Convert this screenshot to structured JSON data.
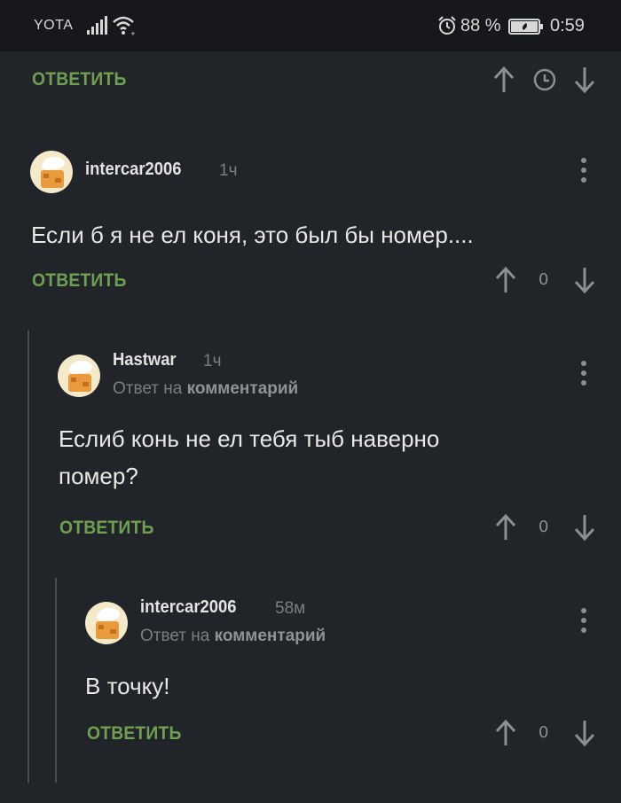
{
  "status_bar": {
    "carrier": "YOTA",
    "battery_percent": "88 %",
    "time": "0:59"
  },
  "top_actions": {
    "reply_label": "ОТВЕТИТЬ"
  },
  "comments": [
    {
      "username": "intercar2006",
      "time": "1ч",
      "reply_to_prefix": "",
      "reply_to_target": "",
      "text": "Если б я не ел коня, это был бы номер....",
      "reply_label": "ОТВЕТИТЬ",
      "rating": "0"
    },
    {
      "username": "Hastwar",
      "time": "1ч",
      "reply_to_prefix": "Ответ на",
      "reply_to_target": "комментарий",
      "text_line1": "Еслиб конь не ел тебя тыб наверно",
      "text_line2": "помер?",
      "reply_label": "ОТВЕТИТЬ",
      "rating": "0"
    },
    {
      "username": "intercar2006",
      "time": "58м",
      "reply_to_prefix": "Ответ на",
      "reply_to_target": "комментарий",
      "text": "В точку!",
      "reply_label": "ОТВЕТИТЬ",
      "rating": "0"
    }
  ],
  "colors": {
    "background": "#212429",
    "accent_green": "#6f9f50",
    "muted": "#7b7e82"
  },
  "icons": [
    "signal-icon",
    "wifi-icon",
    "alarm-icon",
    "battery-icon",
    "arrow-up-icon",
    "clock-icon",
    "arrow-down-icon",
    "more-vertical-icon",
    "avatar-chef-icon"
  ]
}
